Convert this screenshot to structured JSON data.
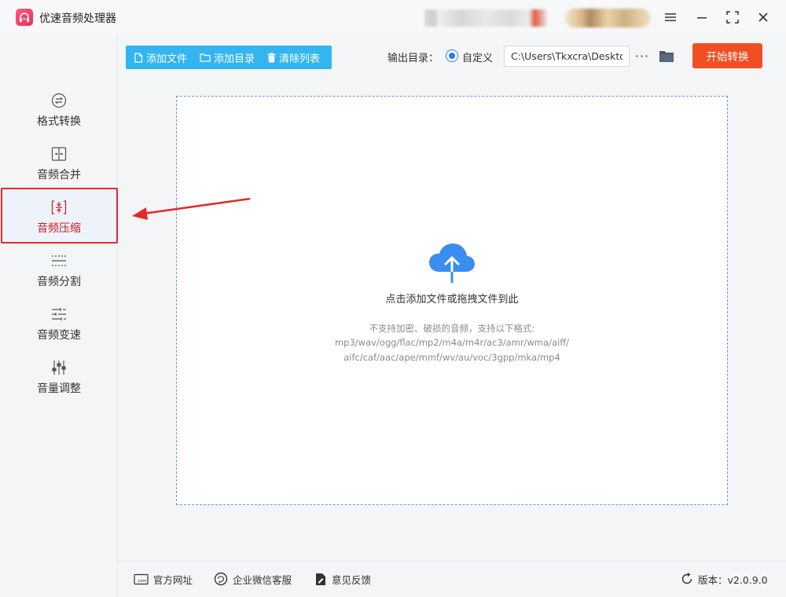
{
  "app": {
    "title": "优速音频处理器",
    "logo_icon": "headphones-icon",
    "brand_color": "#e8335a"
  },
  "window_controls": {
    "menu_icon": "menu-icon",
    "minimize_icon": "minimize-icon",
    "maximize_icon": "maximize-icon",
    "close_icon": "close-icon"
  },
  "sidebar": {
    "items": [
      {
        "label": "格式转换",
        "icon": "format-convert-icon"
      },
      {
        "label": "音频合并",
        "icon": "merge-icon"
      },
      {
        "label": "音频压缩",
        "icon": "compress-icon",
        "active": true
      },
      {
        "label": "音频分割",
        "icon": "split-icon"
      },
      {
        "label": "音频变速",
        "icon": "speed-icon"
      },
      {
        "label": "音量调整",
        "icon": "volume-icon"
      }
    ],
    "active_color": "#c81e1e"
  },
  "toolbar": {
    "add_file": "添加文件",
    "add_folder": "添加目录",
    "clear_list": "清除列表",
    "accent": "#33b5f0"
  },
  "output": {
    "label": "输出目录：",
    "option_label": "自定义",
    "path_value": "C:\\Users\\Tkxcra\\Desktop",
    "more_label": "···",
    "folder_icon": "folder-icon"
  },
  "start_button": {
    "label": "开始转换",
    "color": "#f04e23"
  },
  "dropzone": {
    "main_text": "点击添加文件或拖拽文件到此",
    "note_line1": "不支持加密、破损的音频，支持以下格式:",
    "note_line2": "mp3/wav/ogg/flac/mp2/m4a/m4r/ac3/amr/wma/aiff/",
    "note_line3": "aifc/caf/aac/ape/mmf/wv/au/voc/3gpp/mka/mp4",
    "icon": "cloud-upload-icon"
  },
  "footer": {
    "website": "官方网址",
    "wechat_service": "企业微信客服",
    "feedback": "意见反馈",
    "version": "版本：v2.0.9.0"
  }
}
